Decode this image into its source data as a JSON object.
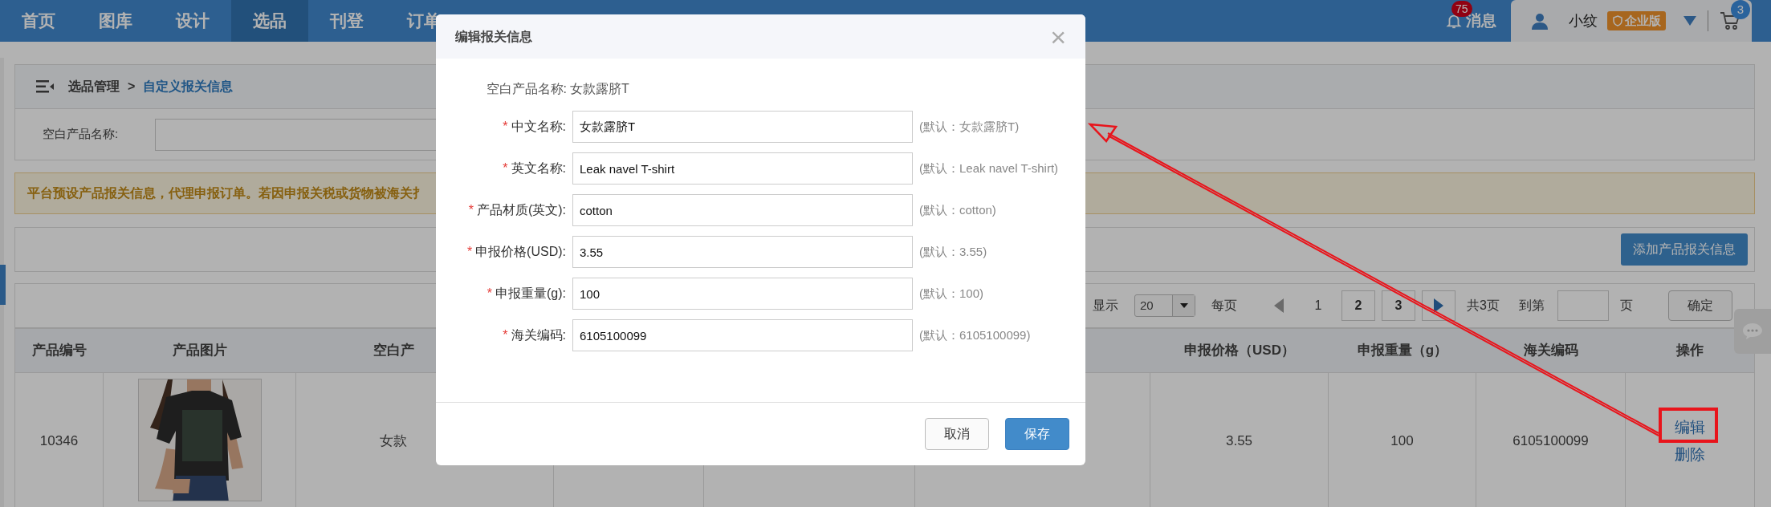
{
  "nav": {
    "items": [
      {
        "label": "首页",
        "selected": false
      },
      {
        "label": "图库",
        "selected": false
      },
      {
        "label": "设计",
        "selected": false
      },
      {
        "label": "选品",
        "selected": true
      },
      {
        "label": "刊登",
        "selected": false
      },
      {
        "label": "订单",
        "selected": false
      }
    ],
    "messages": {
      "label": "消息",
      "count": "75"
    },
    "user": {
      "name": "小纹",
      "edition": "企业版"
    },
    "cart": {
      "count": "3"
    }
  },
  "breadcrumb": {
    "parent": "选品管理",
    "separator": ">",
    "current": "自定义报关信息"
  },
  "search": {
    "label": "空白产品名称:"
  },
  "notice": "平台预设产品报关信息，代理申报订单。若因申报关税或货物被海关扌",
  "toolbar": {
    "add_button": "添加产品报关信息"
  },
  "pagination": {
    "show_label": "显示",
    "page_size": "20",
    "per_page": "每页",
    "pages": [
      {
        "label": "1",
        "selected": true
      },
      {
        "label": "2",
        "selected": false
      },
      {
        "label": "3",
        "selected": false
      }
    ],
    "total": "共3页",
    "goto_label": "到第",
    "page_unit": "页",
    "confirm": "确定"
  },
  "table": {
    "columns": [
      "产品编号",
      "产品图片",
      "空白产",
      "申报价格（USD）",
      "申报重量（g）",
      "海关编码",
      "操作"
    ],
    "rows": [
      {
        "id": "10346",
        "image": {
          "kind": "picture"
        },
        "blank_name": "女款",
        "price": "3.55",
        "weight": "100",
        "hs_code": "6105100099",
        "actions": [
          "编辑",
          "删除"
        ]
      }
    ]
  },
  "dialog": {
    "title": "编辑报关信息",
    "close": "×",
    "required_mark": "*",
    "product": {
      "label": "空白产品名称:",
      "value": "女款露脐T"
    },
    "fields": [
      {
        "label": "中文名称:",
        "required": true,
        "value": "女款露脐T",
        "hint": "(默认：女款露脐T)"
      },
      {
        "label": "英文名称:",
        "required": true,
        "value": "Leak navel T-shirt",
        "hint": "(默认：Leak navel T-shirt)"
      },
      {
        "label": "产品材质(英文):",
        "required": true,
        "value": "cotton",
        "hint": "(默认：cotton)"
      },
      {
        "label": "申报价格(USD):",
        "required": true,
        "value": "3.55",
        "hint": "(默认：3.55)"
      },
      {
        "label": "申报重量(g):",
        "required": true,
        "value": "100",
        "hint": "(默认：100)"
      },
      {
        "label": "海关编码:",
        "required": true,
        "value": "6105100099",
        "hint": "(默认：6105100099)"
      }
    ],
    "buttons": [
      {
        "label": "取消",
        "kind": "secondary"
      },
      {
        "label": "保存",
        "kind": "primary"
      }
    ]
  }
}
